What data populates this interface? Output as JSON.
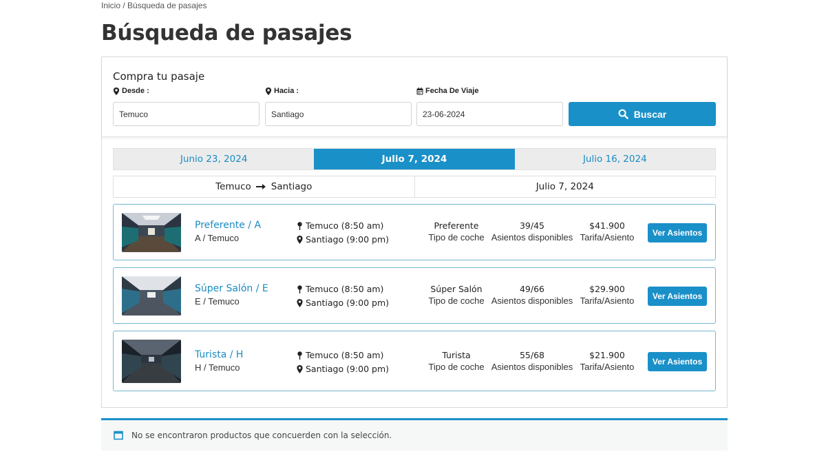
{
  "breadcrumb": "Inicio / Búsqueda de pasajes",
  "page_title": "Búsqueda de pasajes",
  "search": {
    "title": "Compra tu pasaje",
    "from_label": "Desde :",
    "from_value": "Temuco",
    "to_label": "Hacia :",
    "to_value": "Santiago",
    "date_label": "Fecha De Viaje",
    "date_value": "23-06-2024",
    "button_label": "Buscar"
  },
  "date_tabs": [
    {
      "label": "Junio 23, 2024",
      "active": false
    },
    {
      "label": "Julio 7, 2024",
      "active": true
    },
    {
      "label": "Julio 16, 2024",
      "active": false
    }
  ],
  "route": {
    "origin": "Temuco",
    "destination": "Santiago",
    "date": "Julio 7, 2024"
  },
  "trips": [
    {
      "name": "Preferente / A",
      "sub": "A / Temuco",
      "departure": "Temuco (8:50 am)",
      "arrival": "Santiago (9:00 pm)",
      "coach_type": "Preferente",
      "coach_type_label": "Tipo de coche",
      "seats": "39/45",
      "seats_label": "Asientos disponibles",
      "fare": "$41.900",
      "fare_label": "Tarifa/Asiento",
      "button_label": "Ver Asientos"
    },
    {
      "name": "Súper Salón / E",
      "sub": "E / Temuco",
      "departure": "Temuco (8:50 am)",
      "arrival": "Santiago (9:00 pm)",
      "coach_type": "Súper Salón",
      "coach_type_label": "Tipo de coche",
      "seats": "49/66",
      "seats_label": "Asientos disponibles",
      "fare": "$29.900",
      "fare_label": "Tarifa/Asiento",
      "button_label": "Ver Asientos"
    },
    {
      "name": "Turista / H",
      "sub": "H / Temuco",
      "departure": "Temuco (8:50 am)",
      "arrival": "Santiago (9:00 pm)",
      "coach_type": "Turista",
      "coach_type_label": "Tipo de coche",
      "seats": "55/68",
      "seats_label": "Asientos disponibles",
      "fare": "$21.900",
      "fare_label": "Tarifa/Asiento",
      "button_label": "Ver Asientos"
    }
  ],
  "notice": "No se encontraron productos que concuerden con la selección.",
  "colors": {
    "accent": "#1a90c8",
    "link": "#1a8cc2",
    "card_border": "#74b7cf"
  },
  "icons": {
    "location": "map-marker-icon",
    "calendar": "calendar-icon",
    "search": "search-icon",
    "arrow": "arrow-right-icon",
    "notice": "window-icon"
  }
}
